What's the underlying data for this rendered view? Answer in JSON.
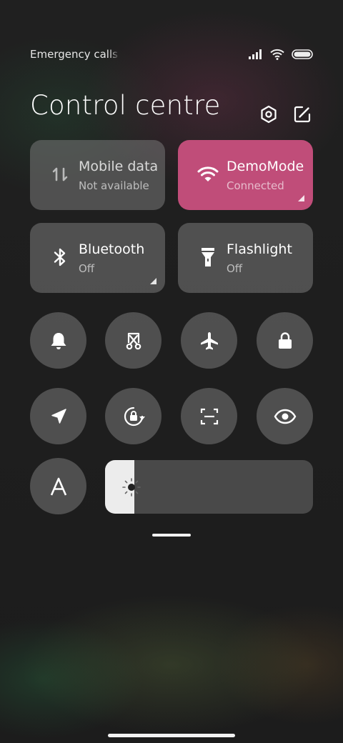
{
  "status_bar": {
    "carrier_text": "Emergency calls only",
    "icons": [
      "signal-icon",
      "wifi-icon",
      "battery-icon"
    ]
  },
  "header": {
    "title": "Control centre",
    "icons": [
      "settings-icon",
      "edit-icon"
    ]
  },
  "tiles": [
    {
      "id": "mobile-data",
      "label": "Mobile data",
      "status": "Not available",
      "icon": "mobile-data-icon",
      "active": false
    },
    {
      "id": "wifi",
      "label": "DemoMode",
      "status": "Connected",
      "icon": "wifi-icon",
      "active": true
    },
    {
      "id": "bluetooth",
      "label": "Bluetooth",
      "status": "Off",
      "icon": "bluetooth-icon",
      "active": false
    },
    {
      "id": "flashlight",
      "label": "Flashlight",
      "status": "Off",
      "icon": "flashlight-icon",
      "active": false
    }
  ],
  "toggles": [
    "bell-icon",
    "screenshot-icon",
    "airplane-icon",
    "lock-icon",
    "location-icon",
    "rotation-lock-icon",
    "scan-icon",
    "reading-mode-icon",
    "font-icon"
  ],
  "brightness": {
    "level": 0.14,
    "icon": "brightness-icon"
  },
  "colors": {
    "active_tile": "#c04d79",
    "tile": "#6e6e6e",
    "slider_fill": "#ececec"
  }
}
